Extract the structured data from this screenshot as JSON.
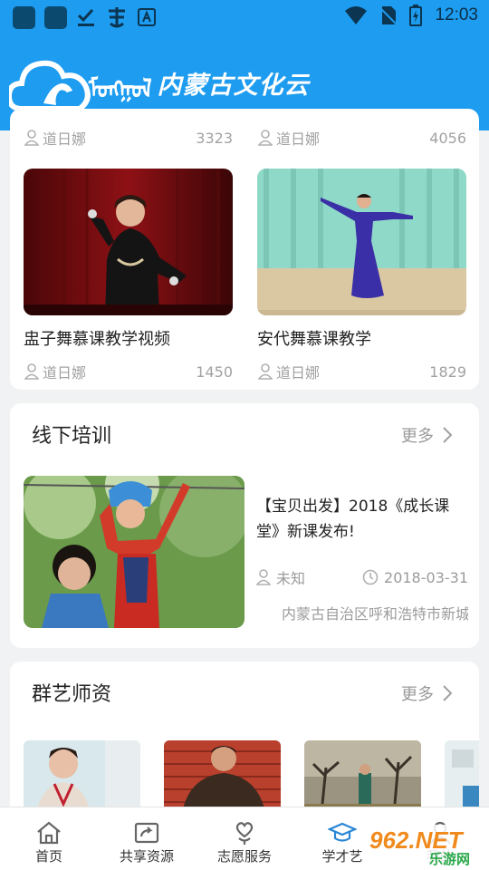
{
  "status_bar": {
    "time": "12:03"
  },
  "header": {
    "title": "内蒙古文化云",
    "mongolian_text": "ᠮᠣᠩᠭᠣᠯ",
    "logo_icon": "cloud-horse-logo-icon"
  },
  "videos": {
    "prev_row": [
      {
        "author": "道日娜",
        "views": "3323"
      },
      {
        "author": "道日娜",
        "views": "4056"
      }
    ],
    "items": [
      {
        "title": "盅子舞慕课教学视频",
        "author": "道日娜",
        "views": "1450"
      },
      {
        "title": "安代舞慕课教学",
        "author": "道日娜",
        "views": "1829"
      }
    ]
  },
  "offline_training": {
    "title": "线下培训",
    "more": "更多",
    "item": {
      "title": "【宝贝出发】2018《成长课堂》新课发布!",
      "author": "未知",
      "date": "2018-03-31",
      "address": "内蒙古自治区呼和浩特市新城区"
    }
  },
  "teachers": {
    "title": "群艺师资",
    "more": "更多"
  },
  "tab_bar": {
    "items": [
      {
        "label": "首页",
        "icon": "home-icon"
      },
      {
        "label": "共享资源",
        "icon": "share-icon"
      },
      {
        "label": "志愿服务",
        "icon": "heart-hand-icon"
      },
      {
        "label": "学才艺",
        "icon": "graduation-cap-icon"
      },
      {
        "label": "我的",
        "icon": "user-icon"
      }
    ]
  },
  "watermark": {
    "text": "962.NET",
    "sub": "乐游网"
  },
  "colors": {
    "brand_blue": "#1e9cf0",
    "watermark_orange": "#f08a1c"
  }
}
